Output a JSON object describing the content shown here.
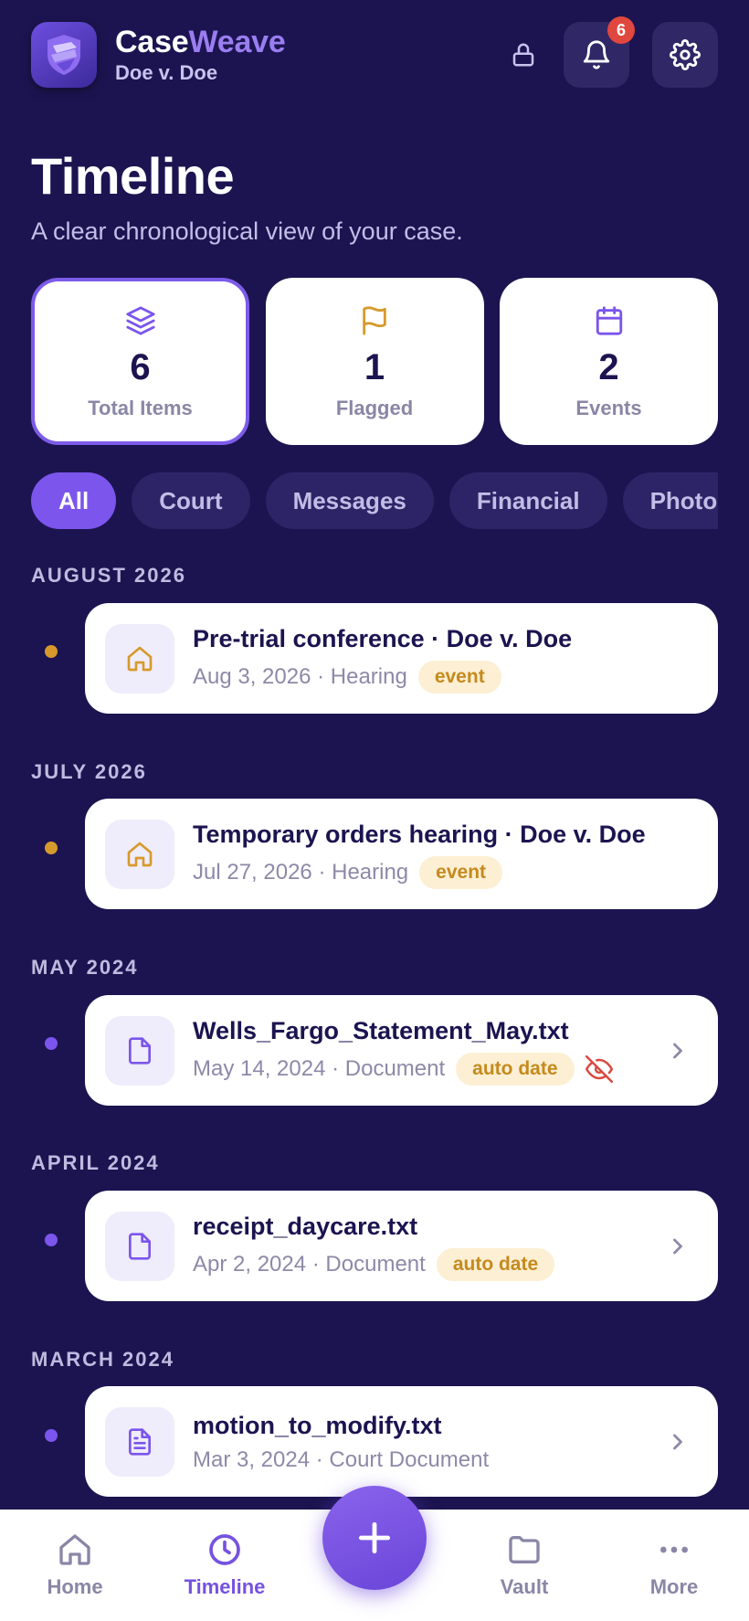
{
  "header": {
    "brand_part1": "Case",
    "brand_part2": "Weave",
    "case_name": "Doe v. Doe",
    "notification_count": "6"
  },
  "page": {
    "title": "Timeline",
    "subtitle": "A clear chronological view of your case."
  },
  "stats": [
    {
      "value": "6",
      "label": "Total Items",
      "icon": "layers-icon"
    },
    {
      "value": "1",
      "label": "Flagged",
      "icon": "flag-icon"
    },
    {
      "value": "2",
      "label": "Events",
      "icon": "calendar-icon"
    }
  ],
  "filters": [
    "All",
    "Court",
    "Messages",
    "Financial",
    "Photos"
  ],
  "timeline": [
    {
      "month": "AUGUST 2026",
      "title": "Pre-trial conference · Doe v. Doe",
      "date": "Aug 3, 2026",
      "type": "Hearing",
      "tag": "event",
      "icon": "home-icon"
    },
    {
      "month": "JULY 2026",
      "title": "Temporary orders hearing · Doe v. Doe",
      "date": "Jul 27, 2026",
      "type": "Hearing",
      "tag": "event",
      "icon": "home-icon"
    },
    {
      "month": "MAY 2024",
      "title": "Wells_Fargo_Statement_May.txt",
      "date": "May 14, 2024",
      "type": "Document",
      "tag": "auto date",
      "icon": "file-icon"
    },
    {
      "month": "APRIL 2024",
      "title": "receipt_daycare.txt",
      "date": "Apr 2, 2024",
      "type": "Document",
      "tag": "auto date",
      "icon": "file-icon"
    },
    {
      "month": "MARCH 2024",
      "title": "motion_to_modify.txt",
      "date": "Mar 3, 2024",
      "type": "Court Document",
      "tag": "",
      "icon": "file-text-icon"
    }
  ],
  "nav": {
    "home": "Home",
    "timeline": "Timeline",
    "vault": "Vault",
    "more": "More"
  },
  "colors": {
    "background": "#1c1450",
    "accent": "#7b55ec",
    "event_dot": "#d69a2c",
    "document_dot": "#7b55ec",
    "tag_bg": "#fcefd3",
    "danger": "#e0473e"
  }
}
